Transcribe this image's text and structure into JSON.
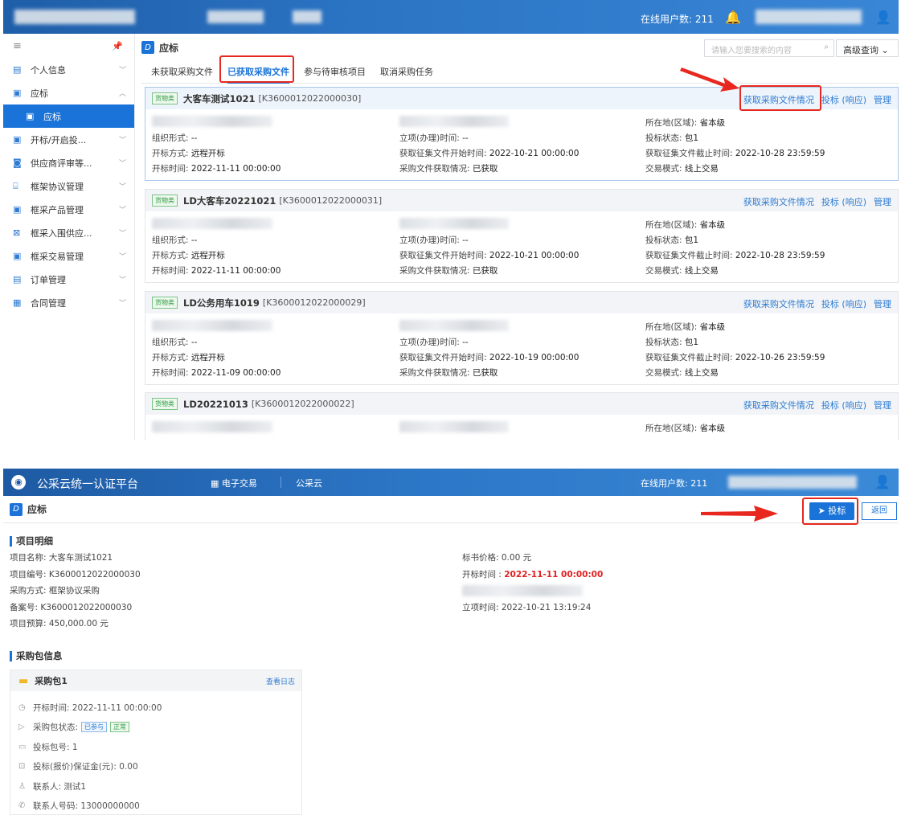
{
  "shot1": {
    "header": {
      "online_users": "在线用户数: 211"
    },
    "sidebar": {
      "menu_icon": "≡",
      "items": [
        {
          "label": "个人信息"
        },
        {
          "label": "应标"
        },
        {
          "label": "应标"
        },
        {
          "label": "开标/开启投..."
        },
        {
          "label": "供应商评审等..."
        },
        {
          "label": "框架协议管理"
        },
        {
          "label": "框采产品管理"
        },
        {
          "label": "框采入围供应..."
        },
        {
          "label": "框采交易管理"
        },
        {
          "label": "订单管理"
        },
        {
          "label": "合同管理"
        }
      ]
    },
    "main": {
      "title": "应标",
      "search_placeholder": "请输入您要搜索的内容",
      "advanced_query": "高级查询",
      "tabs": [
        "未获取采购文件",
        "已获取采购文件",
        "参与待审核项目",
        "取消采购任务"
      ],
      "links": {
        "doc": "获取采购文件情况",
        "bid": "投标 (响应)",
        "manage": "管理"
      },
      "goods_tag": "货物类",
      "labels": {
        "org": "组织形式:",
        "open_mode": "开标方式:",
        "open_time": "开标时间:",
        "approval": "立项(办理)时间:",
        "collect_start": "获取征集文件开始时间:",
        "doc_status": "采购文件获取情况:",
        "region": "所在地(区域):",
        "bid_status": "投标状态:",
        "collect_end": "获取征集文件截止时间:",
        "trade_mode": "交易模式:"
      },
      "cards": [
        {
          "name": "大客车测试1021",
          "code": "[K3600012022000030]",
          "org": "--",
          "open_mode": "远程开标",
          "open_time": "2022-11-11 00:00:00",
          "approval": "--",
          "collect_start": "2022-10-21 00:00:00",
          "doc_status": "已获取",
          "region": "省本级",
          "bid_status": "包1",
          "collect_end": "2022-10-28 23:59:59",
          "trade_mode": "线上交易"
        },
        {
          "name": "LD大客车20221021",
          "code": "[K3600012022000031]",
          "org": "--",
          "open_mode": "远程开标",
          "open_time": "2022-11-11 00:00:00",
          "approval": "--",
          "collect_start": "2022-10-21 00:00:00",
          "doc_status": "已获取",
          "region": "省本级",
          "bid_status": "包1",
          "collect_end": "2022-10-28 23:59:59",
          "trade_mode": "线上交易"
        },
        {
          "name": "LD公务用车1019",
          "code": "[K3600012022000029]",
          "org": "--",
          "open_mode": "远程开标",
          "open_time": "2022-11-09 00:00:00",
          "approval": "--",
          "collect_start": "2022-10-19 00:00:00",
          "doc_status": "已获取",
          "region": "省本级",
          "bid_status": "包1",
          "collect_end": "2022-10-26 23:59:59",
          "trade_mode": "线上交易"
        },
        {
          "name": "LD20221013",
          "code": "[K3600012022000022]",
          "region": "省本级"
        }
      ]
    }
  },
  "shot2": {
    "header": {
      "platform_title": "公采云统一认证平台",
      "nav_trade": "电子交易",
      "nav_cloud": "公采云",
      "online_users": "在线用户数: 211"
    },
    "page_title": "应标",
    "bid_button": "投标",
    "back_button": "返回",
    "section_project": "项目明细",
    "project": {
      "name": "项目名称: 大客车测试1021",
      "code": "项目编号: K3600012022000030",
      "method": "采购方式: 框架协议采购",
      "record": "备案号: K3600012022000030",
      "budget": "项目预算: 450,000.00 元",
      "price": "标书价格: 0.00 元",
      "open_label": "开标时间 : ",
      "open_time": "2022-11-11 00:00:00",
      "approval": "立项时间: 2022-10-21 13:19:24"
    },
    "section_package": "采购包信息",
    "package": {
      "name": "采购包1",
      "view_log": "查看日志",
      "open_time": "开标时间: 2022-11-11 00:00:00",
      "status_label": "采购包状态:",
      "status_joined": "已参与",
      "status_normal": "正常",
      "bid_no": "投标包号: 1",
      "deposit": "投标(报价)保证金(元): 0.00",
      "contact": "联系人: 测试1",
      "phone": "联系人号码: 13000000000"
    }
  },
  "colors": {
    "primary": "#1a73d8",
    "highlight": "#e8281f",
    "header": "#2b74c4"
  }
}
